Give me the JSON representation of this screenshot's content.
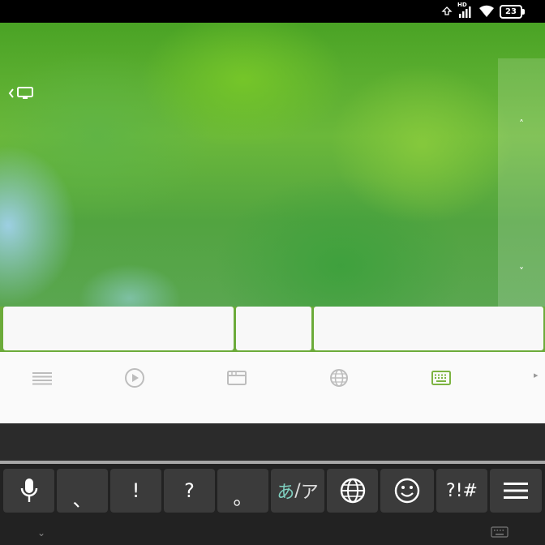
{
  "status_bar": {
    "network_label": "HD",
    "battery_level": "23",
    "icons": [
      "upload-arrow-icon",
      "signal-icon",
      "wifi-icon",
      "battery-icon"
    ]
  },
  "wallpaper": {
    "colors": {
      "primary": "#5aa83a",
      "highlight": "#8fd24a",
      "accent_blue": "#aad6ff"
    }
  },
  "overlay": {
    "back_icon": "chevron-left-icon",
    "display_icon": "monitor-icon",
    "scroll_up_label": "˄",
    "scroll_down_label": "˅"
  },
  "tabs": {
    "items": [
      {
        "icon": "list-icon",
        "active": false
      },
      {
        "icon": "play-circle-icon",
        "active": false
      },
      {
        "icon": "window-icon",
        "active": false
      },
      {
        "icon": "globe-icon",
        "active": false
      },
      {
        "icon": "keyboard-icon",
        "active": true
      }
    ],
    "more_label": "▸",
    "active_color": "#7cb342",
    "inactive_color": "#bdbdbd"
  },
  "keyboard": {
    "keys": {
      "comma": "、",
      "exclaim": "!",
      "question": "?",
      "period": "。",
      "kana_hiragana": "あ",
      "kana_sep": "/",
      "kana_katakana": "ア",
      "symbols": "?!#"
    },
    "kana_accent": "#7fd0c0",
    "collapse_label": "⌄"
  }
}
